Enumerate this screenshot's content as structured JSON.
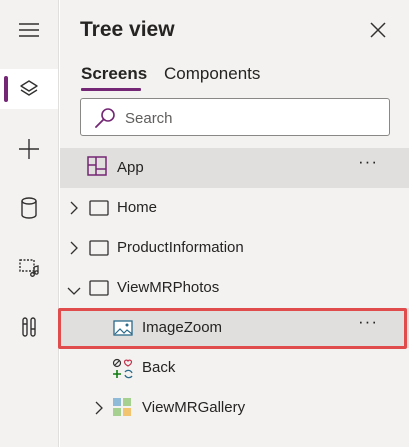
{
  "rail": {
    "items": [
      {
        "name": "hamburger-menu-icon"
      },
      {
        "name": "tree-view-layers-icon",
        "active": true
      },
      {
        "name": "insert-plus-icon"
      },
      {
        "name": "data-cylinder-icon"
      },
      {
        "name": "media-icon"
      },
      {
        "name": "advanced-tools-icon"
      }
    ]
  },
  "panel": {
    "title": "Tree view",
    "tabs": [
      {
        "label": "Screens",
        "selected": true
      },
      {
        "label": "Components",
        "selected": false
      }
    ],
    "search": {
      "placeholder": "Search"
    },
    "more_label": "···",
    "tree": [
      {
        "label": "App",
        "icon": "app-icon",
        "expandable": false
      },
      {
        "label": "Home",
        "icon": "screen-icon",
        "expandable": true,
        "expanded": false
      },
      {
        "label": "ProductInformation",
        "icon": "screen-icon",
        "expandable": true,
        "expanded": false
      },
      {
        "label": "ViewMRPhotos",
        "icon": "screen-icon",
        "expandable": true,
        "expanded": true
      },
      {
        "label": "ImageZoom",
        "icon": "image-icon",
        "selected": true
      },
      {
        "label": "Back",
        "icon": "icon-control-icon"
      },
      {
        "label": "ViewMRGallery",
        "icon": "gallery-icon",
        "expandable": true,
        "expanded": false
      }
    ]
  },
  "colors": {
    "accent": "#742774",
    "highlight": "#e04b4b",
    "panel_bg": "#f3f2f1",
    "selected_bg": "#e1dfdd"
  }
}
